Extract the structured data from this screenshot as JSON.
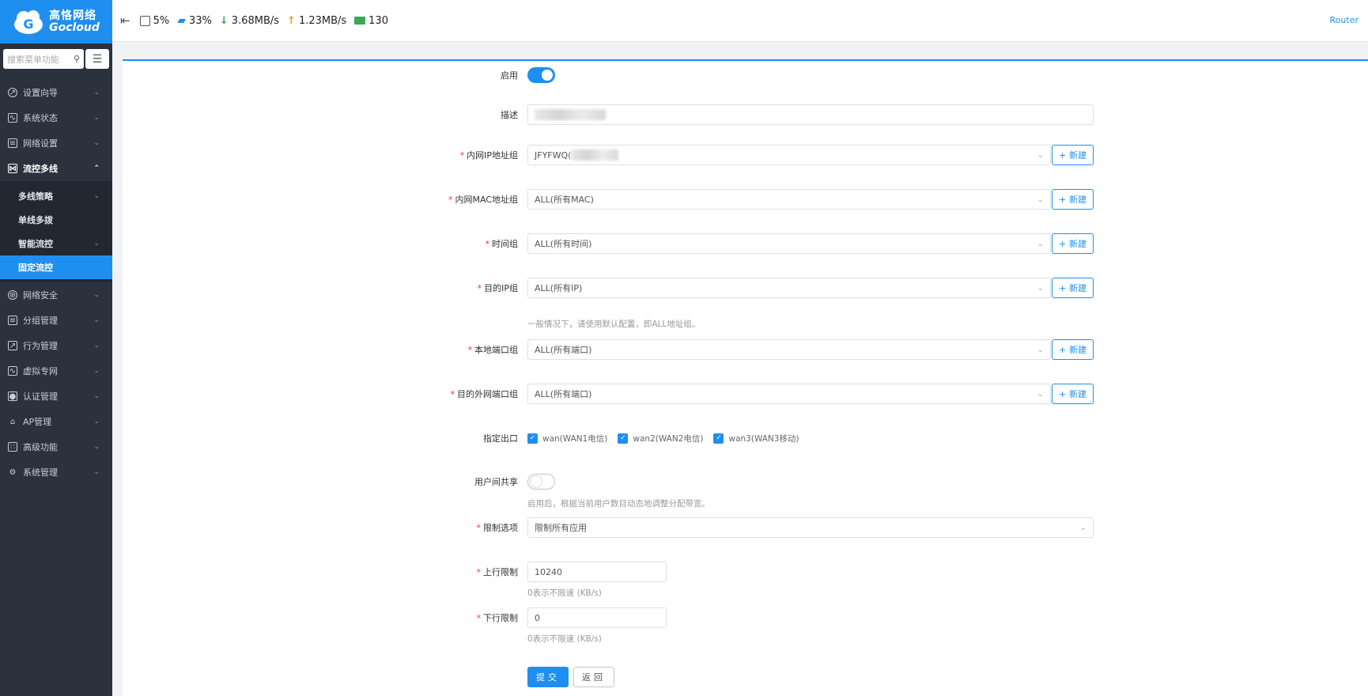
{
  "brand": {
    "cn": "高恪网络",
    "en": "Gocloud"
  },
  "header": {
    "cpu": "5%",
    "mem": "33%",
    "down": "3.68MB/s",
    "up": "1.23MB/s",
    "clients": "130",
    "router_link": "Router"
  },
  "search": {
    "placeholder": "搜索菜单功能"
  },
  "sidebar": {
    "items": [
      {
        "label": "设置向导"
      },
      {
        "label": "系统状态"
      },
      {
        "label": "网络设置"
      },
      {
        "label": "流控多线"
      },
      {
        "label": "网络安全"
      },
      {
        "label": "分组管理"
      },
      {
        "label": "行为管理"
      },
      {
        "label": "虚拟专网"
      },
      {
        "label": "认证管理"
      },
      {
        "label": "AP管理"
      },
      {
        "label": "高级功能"
      },
      {
        "label": "系统管理"
      }
    ],
    "subitems": [
      {
        "label": "多线策略"
      },
      {
        "label": "单线多拨"
      },
      {
        "label": "智能流控"
      },
      {
        "label": "固定流控"
      }
    ]
  },
  "form": {
    "enable_label": "启用",
    "desc_label": "描述",
    "lan_ip_label": "内网IP地址组",
    "lan_ip_value": "JFYFWQ(",
    "lan_mac_label": "内网MAC地址组",
    "lan_mac_value": "ALL(所有MAC)",
    "time_label": "时间组",
    "time_value": "ALL(所有时间)",
    "dst_ip_label": "目的IP组",
    "dst_ip_value": "ALL(所有IP)",
    "dst_ip_hint": "一般情况下，请使用默认配置，即ALL地址组。",
    "local_port_label": "本地端口组",
    "local_port_value": "ALL(所有端口)",
    "dst_port_label": "目的外网端口组",
    "dst_port_value": "ALL(所有端口)",
    "new_label": "新建",
    "outlet_label": "指定出口",
    "outlets": [
      {
        "label": "wan(WAN1电信)"
      },
      {
        "label": "wan2(WAN2电信)"
      },
      {
        "label": "wan3(WAN3移动)"
      }
    ],
    "share_label": "用户间共享",
    "share_hint": "启用后，根据当前用户数目动态地调整分配带宽。",
    "limit_opt_label": "限制选项",
    "limit_opt_value": "限制所有应用",
    "up_label": "上行限制",
    "up_value": "10240",
    "up_hint": "0表示不限速 (KB/s)",
    "down_label": "下行限制",
    "down_value": "0",
    "down_hint": "0表示不限速 (KB/s)",
    "submit_label": "提交",
    "back_label": "返回"
  },
  "colors": {
    "accent": "#1e8ff0",
    "sidebar": "#2b323d",
    "required": "#e33333"
  }
}
